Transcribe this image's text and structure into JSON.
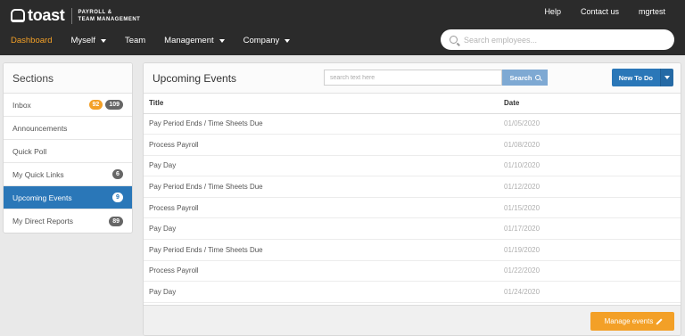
{
  "header": {
    "logo_text": "toast",
    "logo_sub_line1": "PAYROLL &",
    "logo_sub_line2": "TEAM MANAGEMENT",
    "links": [
      "Help",
      "Contact us",
      "mgrtest"
    ],
    "nav": [
      {
        "label": "Dashboard",
        "dropdown": false,
        "active": true
      },
      {
        "label": "Myself",
        "dropdown": true,
        "active": false
      },
      {
        "label": "Team",
        "dropdown": false,
        "active": false
      },
      {
        "label": "Management",
        "dropdown": true,
        "active": false
      },
      {
        "label": "Company",
        "dropdown": true,
        "active": false
      }
    ],
    "search_placeholder": "Search employees..."
  },
  "sidebar": {
    "title": "Sections",
    "items": [
      {
        "label": "Inbox",
        "badges": [
          "92",
          "109"
        ]
      },
      {
        "label": "Announcements",
        "badges": []
      },
      {
        "label": "Quick Poll",
        "badges": []
      },
      {
        "label": "My Quick Links",
        "badges": [
          "6"
        ]
      },
      {
        "label": "Upcoming Events",
        "badges": [
          "9"
        ],
        "active": true
      },
      {
        "label": "My Direct Reports",
        "badges": [
          "89"
        ]
      }
    ]
  },
  "main": {
    "title": "Upcoming Events",
    "search_placeholder": "search text here",
    "search_button": "Search",
    "new_todo_button": "New To Do",
    "columns": [
      "Title",
      "Date"
    ],
    "rows": [
      {
        "title": "Pay Period Ends / Time Sheets Due",
        "date": "01/05/2020"
      },
      {
        "title": "Process Payroll",
        "date": "01/08/2020"
      },
      {
        "title": "Pay Day",
        "date": "01/10/2020"
      },
      {
        "title": "Pay Period Ends / Time Sheets Due",
        "date": "01/12/2020"
      },
      {
        "title": "Process Payroll",
        "date": "01/15/2020"
      },
      {
        "title": "Pay Day",
        "date": "01/17/2020"
      },
      {
        "title": "Pay Period Ends / Time Sheets Due",
        "date": "01/19/2020"
      },
      {
        "title": "Process Payroll",
        "date": "01/22/2020"
      },
      {
        "title": "Pay Day",
        "date": "01/24/2020"
      }
    ],
    "manage_button": "Manage events"
  },
  "colors": {
    "accent_orange": "#f3a027",
    "accent_blue": "#2a77b8",
    "topbar": "#2b2b2b"
  }
}
